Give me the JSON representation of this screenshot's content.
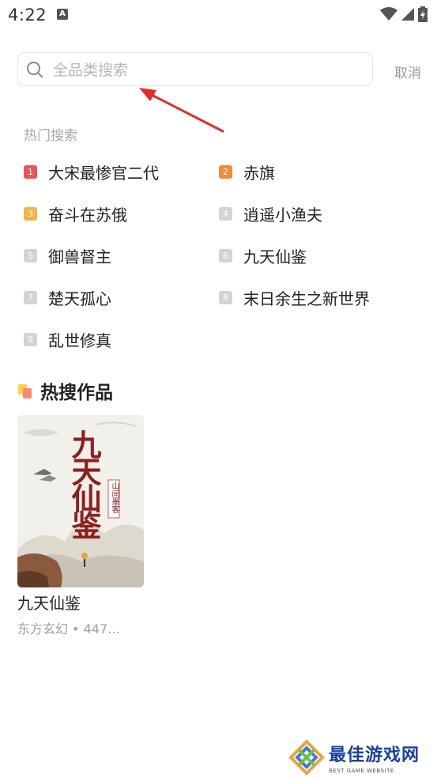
{
  "status_bar": {
    "time": "4:22",
    "notification_glyph": "A"
  },
  "search": {
    "placeholder": "全品类搜索",
    "value": "",
    "cancel_label": "取消"
  },
  "hot_search": {
    "title": "热门搜索",
    "items": [
      {
        "rank": "1",
        "label": "大宋最惨官二代",
        "color": "#e8565a"
      },
      {
        "rank": "2",
        "label": "赤旗",
        "color": "#f28a3a"
      },
      {
        "rank": "3",
        "label": "奋斗在苏俄",
        "color": "#f2b446"
      },
      {
        "rank": "4",
        "label": "逍遥小渔夫",
        "color": "#d3d3d3"
      },
      {
        "rank": "5",
        "label": "御兽督主",
        "color": "#d3d3d3"
      },
      {
        "rank": "6",
        "label": "九天仙鉴",
        "color": "#d3d3d3"
      },
      {
        "rank": "7",
        "label": "楚天孤心",
        "color": "#d3d3d3"
      },
      {
        "rank": "8",
        "label": "末日余生之新世界",
        "color": "#d3d3d3"
      },
      {
        "rank": "9",
        "label": "乱世修真",
        "color": "#d3d3d3"
      }
    ]
  },
  "hot_works": {
    "title": "热搜作品",
    "books": [
      {
        "title": "九天仙鉴",
        "meta": "东方玄幻 • 447…",
        "cover_title": "九天仙鉴",
        "cover_author": "山间墨客"
      }
    ]
  },
  "watermark": {
    "main": "最佳游戏网",
    "sub": "BEST GAME WEBSITE"
  },
  "colors": {
    "accent_red": "#e8565a",
    "arrow_red": "#e52b2b"
  }
}
